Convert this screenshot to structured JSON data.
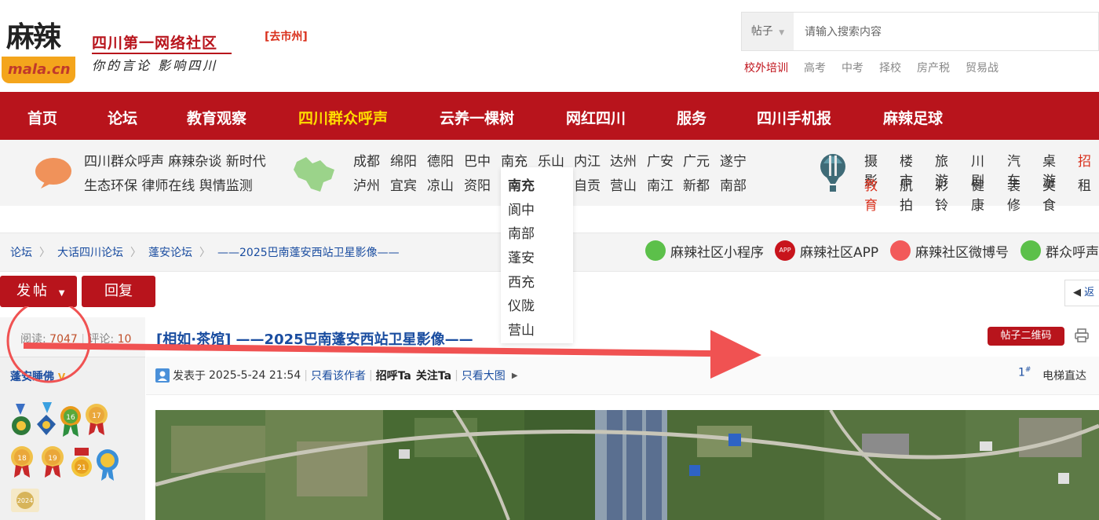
{
  "header": {
    "logo_text": "麻辣",
    "logo_sub": "mala.cn",
    "slogan_title": "四川第一网络社区",
    "slogan_sub": "你的言论 影响四川",
    "city_link": "[去市州]"
  },
  "search": {
    "type_label": "帖子",
    "placeholder": "请输入搜索内容",
    "hot_links": [
      "校外培训",
      "高考",
      "中考",
      "择校",
      "房产税",
      "贸易战"
    ]
  },
  "nav": {
    "items": [
      "首页",
      "论坛",
      "教育观察",
      "四川群众呼声",
      "云养一棵树",
      "网红四川",
      "服务",
      "四川手机报",
      "麻辣足球"
    ],
    "active_index": 3
  },
  "subnav": {
    "intro_row1": "四川群众呼声 麻辣杂谈 新时代",
    "intro_row2": "生态环保 律师在线 舆情监测",
    "cities_row1": [
      "成都",
      "绵阳",
      "德阳",
      "巴中",
      "南充",
      "乐山",
      "内江",
      "达州",
      "广安",
      "广元",
      "遂宁"
    ],
    "cities_row2": [
      "泸州",
      "宜宾",
      "凉山",
      "资阳",
      "",
      "",
      "自贡",
      "营山",
      "南江",
      "新都",
      "南部"
    ],
    "cats_row1": [
      "摄影",
      "楼市",
      "旅游",
      "川剧",
      "汽车",
      "桌游",
      "招"
    ],
    "cats_row2": [
      "教育",
      "航拍",
      "彩铃",
      "健康",
      "装修",
      "美食",
      "租"
    ]
  },
  "dropdown": {
    "items": [
      "南充",
      "阆中",
      "南部",
      "蓬安",
      "西充",
      "仪陇",
      "营山"
    ]
  },
  "breadcrumb": [
    "论坛",
    "大话四川论坛",
    "蓬安论坛",
    "——2025巴南蓬安西站卫星影像——"
  ],
  "social": [
    "麻辣社区小程序",
    "麻辣社区APP",
    "麻辣社区微博号",
    "群众呼声"
  ],
  "actions": {
    "post_label": "发帖",
    "reply_label": "回复",
    "next_page_label": "返"
  },
  "thread": {
    "stats_read_label": "阅读:",
    "stats_read": "7047",
    "stats_reply_label": "评论:",
    "stats_reply": "10",
    "author": "蓬安睡佛",
    "title": "[相如·茶馆] ——2025巴南蓬安西站卫星影像——",
    "qr_label": "帖子二维码",
    "posted_prefix": "发表于",
    "posted_time": "2025-5-24 21:54",
    "only_author": "只看该作者",
    "greet": "招呼Ta",
    "follow": "关注Ta",
    "big_image": "只看大图",
    "floor": "1",
    "floor_mark": "#",
    "elevator": "电梯直达"
  },
  "medals": [
    "",
    "",
    "16",
    "17",
    "18",
    "19",
    "21",
    "",
    "2024"
  ],
  "colors": {
    "brand_red": "#b8141c",
    "nav_active": "#ffdd00",
    "link_blue": "#1a4da0"
  }
}
